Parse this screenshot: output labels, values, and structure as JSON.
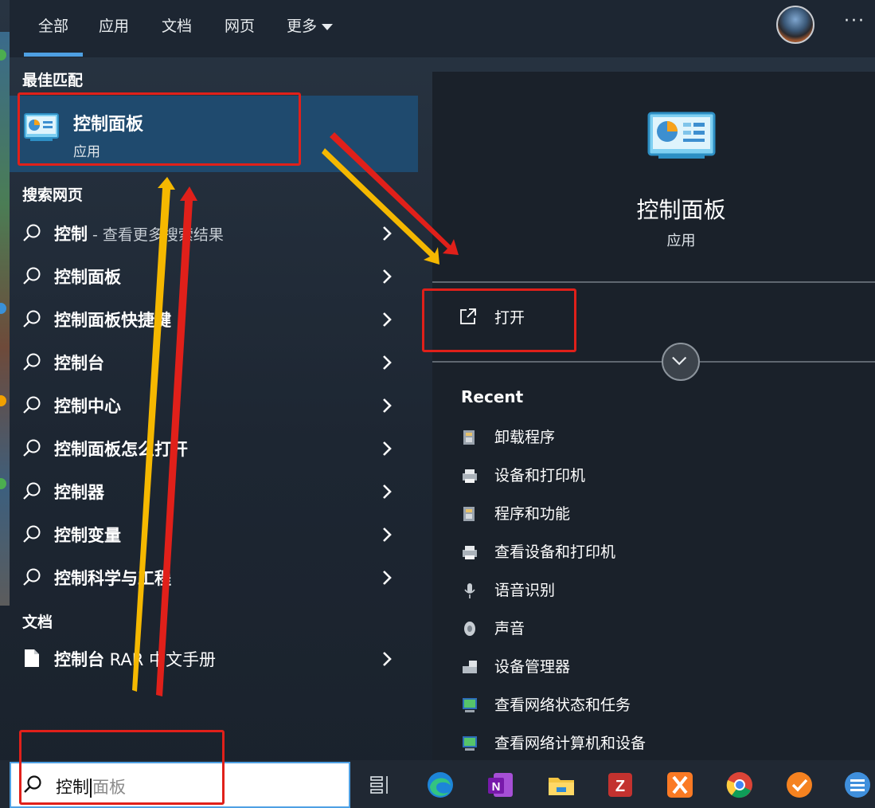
{
  "tabs": [
    {
      "label": "全部",
      "active": true
    },
    {
      "label": "应用"
    },
    {
      "label": "文档"
    },
    {
      "label": "网页"
    },
    {
      "label": "更多"
    }
  ],
  "sections": {
    "best_match": "最佳匹配",
    "search_web": "搜索网页",
    "documents": "文档"
  },
  "best_match": {
    "title": "控制面板",
    "subtitle": "应用"
  },
  "web_results": [
    {
      "bold": "控制",
      "rest": " - 查看更多搜索结果"
    },
    {
      "bold": "控制面板",
      "rest": ""
    },
    {
      "bold": "控制面板快捷键",
      "rest": ""
    },
    {
      "bold": "控制台",
      "rest": ""
    },
    {
      "bold": "控制中心",
      "rest": ""
    },
    {
      "bold": "控制面板怎么打开",
      "rest": ""
    },
    {
      "bold": "控制器",
      "rest": ""
    },
    {
      "bold": "控制变量",
      "rest": ""
    },
    {
      "bold": "控制科学与工程",
      "rest": ""
    }
  ],
  "document_results": [
    {
      "bold": "控制台",
      "rest": " RAR 中文手册"
    }
  ],
  "preview": {
    "title": "控制面板",
    "subtitle": "应用",
    "open_label": "打开",
    "recent_title": "Recent",
    "recent_items": [
      {
        "label": "卸载程序",
        "icon": "programs-icon"
      },
      {
        "label": "设备和打印机",
        "icon": "printer-icon"
      },
      {
        "label": "程序和功能",
        "icon": "programs-icon"
      },
      {
        "label": "查看设备和打印机",
        "icon": "printer-icon"
      },
      {
        "label": "语音识别",
        "icon": "microphone-icon"
      },
      {
        "label": "声音",
        "icon": "speaker-icon"
      },
      {
        "label": "设备管理器",
        "icon": "device-manager-icon"
      },
      {
        "label": "查看网络状态和任务",
        "icon": "network-icon"
      },
      {
        "label": "查看网络计算机和设备",
        "icon": "network-icon"
      }
    ]
  },
  "search": {
    "typed": "控制",
    "suggestion": "面板"
  },
  "taskbar_icons": [
    "task-view-icon",
    "edge-icon",
    "onenote-icon",
    "file-explorer-icon",
    "zotero-icon",
    "xampp-icon",
    "chrome-icon",
    "todo-icon",
    "app-icon"
  ],
  "colors": {
    "accent": "#4ea0e3",
    "selected_row": "#1f4a6e",
    "annotation_red": "#e0201a",
    "annotation_yellow": "#f5b800"
  }
}
